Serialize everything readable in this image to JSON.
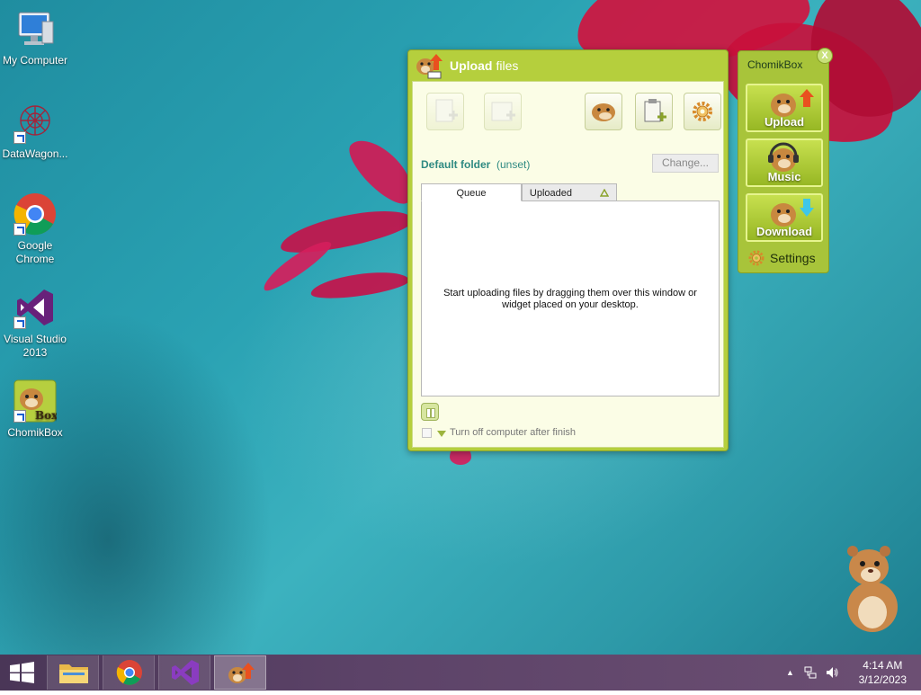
{
  "desktop": {
    "icons": [
      {
        "label": "My Computer"
      },
      {
        "label": "DataWagon..."
      },
      {
        "label": "Google Chrome"
      },
      {
        "label": "Visual Studio 2013"
      },
      {
        "label": "ChomikBox"
      }
    ]
  },
  "upload_window": {
    "title_bold": "Upload",
    "title_rest": "files",
    "default_folder_label": "Default folder",
    "default_folder_value": "(unset)",
    "change_button": "Change...",
    "tabs": [
      {
        "label": "Queue",
        "active": true
      },
      {
        "label": "Uploaded",
        "active": false
      }
    ],
    "empty_message": "Start uploading files by dragging them over this window or widget placed on your desktop.",
    "turn_off_label": "Turn off computer after finish",
    "turn_off_checked": false
  },
  "chomik_panel": {
    "title": "ChomikBox",
    "close_label": "X",
    "buttons": [
      {
        "label": "Upload"
      },
      {
        "label": "Music"
      },
      {
        "label": "Download"
      }
    ],
    "settings_label": "Settings"
  },
  "taskbar": {
    "clock_time": "4:14 AM",
    "clock_date": "3/12/2023"
  },
  "colors": {
    "window_green": "#b5cf3d",
    "accent_teal": "#2f8a82",
    "taskbar": "#5c4368"
  }
}
